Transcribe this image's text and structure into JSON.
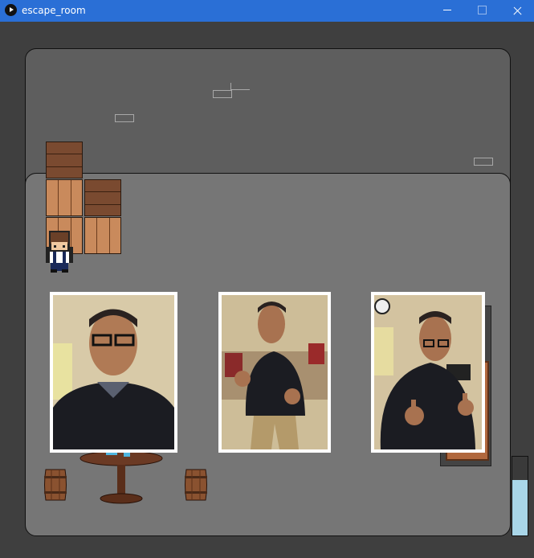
{
  "window": {
    "title": "escape_room",
    "buttons": {
      "minimize": "minimize",
      "maximize": "maximize",
      "close": "close"
    }
  },
  "icons": {
    "app": "play-icon",
    "minimize": "minimize-icon",
    "maximize": "maximize-icon",
    "close": "close-icon"
  },
  "colors": {
    "titlebar": "#2a6fd6",
    "background": "#3f3f3f",
    "floor_back": "#5e5e5e",
    "floor_front": "#767676",
    "crate_light": "#c98a5c",
    "crate_dark": "#7a4a30",
    "meter_fill": "#a9d6e8"
  },
  "game": {
    "photos": [
      {
        "subject": "man-portrait-glasses"
      },
      {
        "subject": "man-boxing-pose"
      },
      {
        "subject": "man-thumbs-up"
      }
    ],
    "meter_level": 0.7
  }
}
